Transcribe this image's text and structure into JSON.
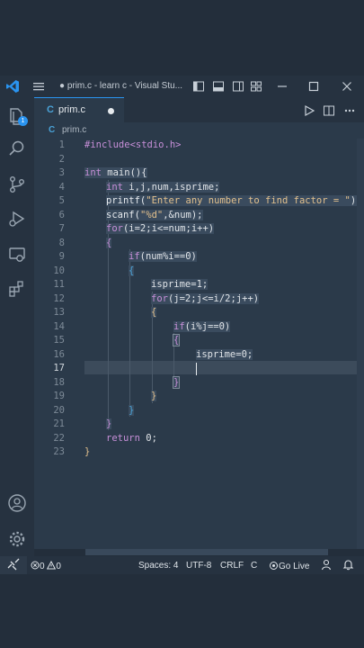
{
  "window": {
    "title": "● prim.c - learn c - Visual Stu..."
  },
  "tab": {
    "icon_letter": "C",
    "filename": "prim.c"
  },
  "breadcrumb": {
    "icon_letter": "C",
    "filename": "prim.c"
  },
  "activity_badge": "1",
  "lines": [
    "1",
    "2",
    "3",
    "4",
    "5",
    "6",
    "7",
    "8",
    "9",
    "10",
    "11",
    "12",
    "13",
    "14",
    "15",
    "16",
    "17",
    "18",
    "19",
    "20",
    "21",
    "22",
    "23"
  ],
  "code": {
    "l1_inc": "#include",
    "l1_hdr": "<stdio.h>",
    "l3_type": "int",
    "l3_rest": " main(){",
    "l4_type": "int",
    "l4_rest": " i,j,num,isprime;",
    "l5_fn": "printf(",
    "l5_str": "\"Enter any number to find factor = \"",
    "l5_end": ");",
    "l6_fn": "scanf(",
    "l6_str": "\"%d\"",
    "l6_end": ",&num);",
    "l7_kw": "for",
    "l7_rest": "(i=2;i<=num;i++)",
    "l8": "{",
    "l9_kw": "if",
    "l9_rest": "(num%i==0)",
    "l10": "{",
    "l11": "isprime=1;",
    "l12_kw": "for",
    "l12_rest": "(j=2;j<=i/2;j++)",
    "l13": "{",
    "l14_kw": "if",
    "l14_rest": "(i%j==0)",
    "l15": "{",
    "l16": "isprime=0;",
    "l18": "}",
    "l19": "}",
    "l20": "}",
    "l21": "}",
    "l22_kw": "return",
    "l22_rest": " 0;",
    "l23": "}"
  },
  "status": {
    "errors": "0",
    "warnings": "0",
    "spaces": "Spaces: 4",
    "encoding": "UTF-8",
    "eol": "CRLF",
    "language": "C",
    "golive": "Go Live"
  },
  "colors": {
    "accent": "#2a94f0",
    "editor_bg": "#2b3a4a",
    "keyword": "#c78fd8",
    "string": "#e2c08d"
  }
}
